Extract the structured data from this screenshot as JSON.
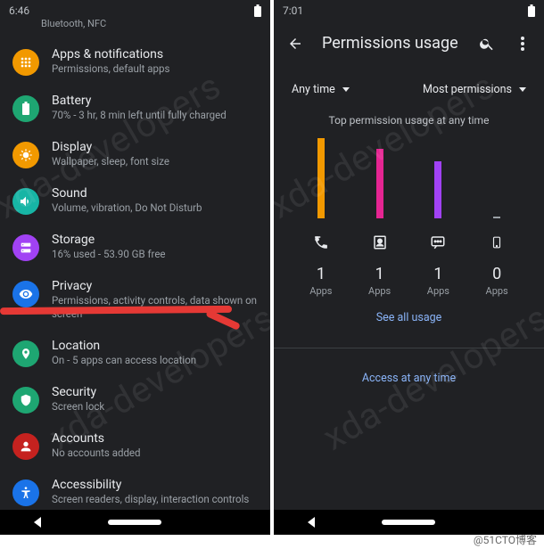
{
  "left": {
    "status": {
      "time": "6:46",
      "sub": "Bluetooth, NFC"
    },
    "items": [
      {
        "title": "Apps & notifications",
        "sub": "Permissions, default apps",
        "color": "#f29900",
        "icon": "apps"
      },
      {
        "title": "Battery",
        "sub": "70% - 3 hr, 8 min left until fully charged",
        "color": "#1ea672",
        "icon": "battery"
      },
      {
        "title": "Display",
        "sub": "Wallpaper, sleep, font size",
        "color": "#f29900",
        "icon": "display"
      },
      {
        "title": "Sound",
        "sub": "Volume, vibration, Do Not Disturb",
        "color": "#17b5a5",
        "icon": "sound"
      },
      {
        "title": "Storage",
        "sub": "16% used - 53.90 GB free",
        "color": "#a142f4",
        "icon": "storage"
      },
      {
        "title": "Privacy",
        "sub": "Permissions, activity controls, data shown on screen",
        "color": "#1a73e8",
        "icon": "privacy"
      },
      {
        "title": "Location",
        "sub": "On - 5 apps can access location",
        "color": "#1ea672",
        "icon": "location"
      },
      {
        "title": "Security",
        "sub": "Screen lock",
        "color": "#1ea672",
        "icon": "security"
      },
      {
        "title": "Accounts",
        "sub": "No accounts added",
        "color": "#c5221f",
        "icon": "accounts"
      },
      {
        "title": "Accessibility",
        "sub": "Screen readers, display, interaction controls",
        "color": "#1a73e8",
        "icon": "accessibility"
      }
    ]
  },
  "right": {
    "status": {
      "time": "7:01"
    },
    "appbar": {
      "title": "Permissions usage"
    },
    "filters": {
      "time": "Any time",
      "sort": "Most permissions"
    },
    "chart_title": "Top permission usage at any time",
    "chart_data": {
      "type": "bar",
      "categories": [
        "phone",
        "contacts",
        "sms",
        "storage"
      ],
      "series": [
        {
          "name": "Apps",
          "values": [
            1,
            1,
            1,
            0
          ]
        }
      ],
      "colors": [
        "#f29900",
        "#e52592",
        "#a142f4",
        "#9aa0a6"
      ],
      "heights": [
        90,
        78,
        64,
        2
      ],
      "title": "Top permission usage at any time",
      "ylabel": "Apps"
    },
    "links": {
      "all_usage": "See all usage",
      "any_time": "Access at any time"
    },
    "apps_label": "Apps"
  },
  "watermark": "xda-developers",
  "attribution": "@51CTO博客"
}
